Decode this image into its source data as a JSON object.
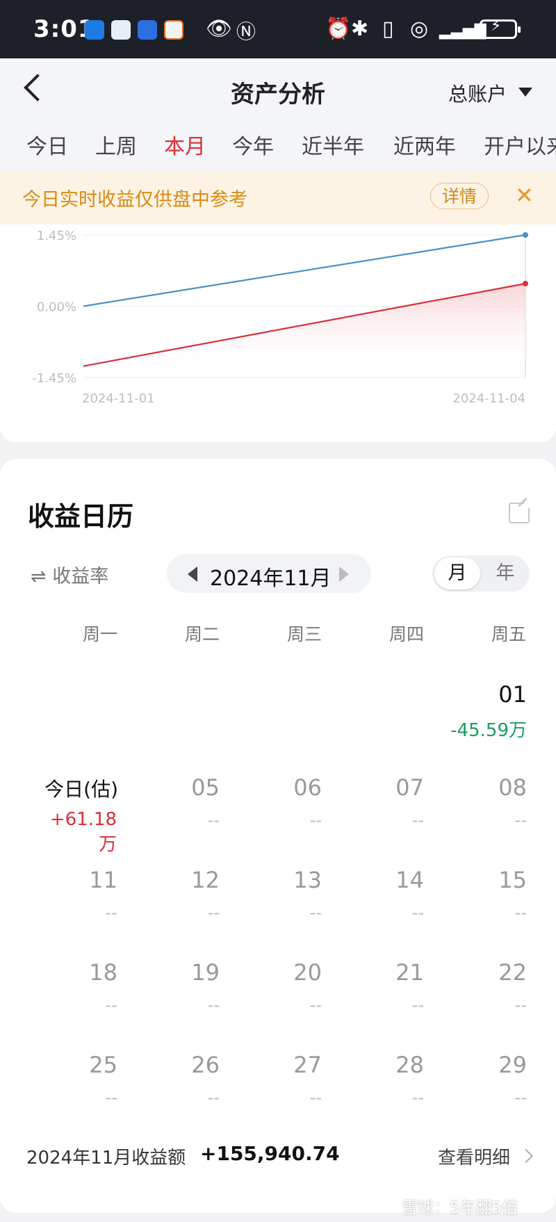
{
  "status_bar": {
    "time": "3:01"
  },
  "header": {
    "title": "资产分析",
    "account": "总账户",
    "tabs": [
      "今日",
      "上周",
      "本月",
      "今年",
      "近半年",
      "近两年",
      "开户以来"
    ],
    "active_tab": "本月"
  },
  "notice": {
    "text": "今日实时收益仅供盘中参考",
    "detail": "详情",
    "close": "✕"
  },
  "chart_data": {
    "type": "line",
    "x": [
      "2024-11-01",
      "2024-11-04"
    ],
    "y_ticks": [
      "1.45%",
      "0.00%",
      "-1.45%"
    ],
    "ylim": [
      -1.45,
      1.45
    ],
    "series": [
      {
        "values": [
          0.0,
          1.45
        ],
        "color": "#4a8fc4"
      },
      {
        "values": [
          -1.22,
          0.46
        ],
        "color": "#d8303a"
      }
    ]
  },
  "calendar": {
    "title": "收益日历",
    "rate_toggle": "⇌ 收益率",
    "month": "2024年11月",
    "seg_month": "月",
    "seg_year": "年",
    "weekdays": [
      "周一",
      "周二",
      "周三",
      "周四",
      "周五"
    ],
    "first": {
      "day": "01",
      "pnl": "-45.59万"
    },
    "today": {
      "label": "今日(估)",
      "pnl": "+61.18万"
    },
    "row1": [
      "05",
      "06",
      "07",
      "08"
    ],
    "row2": [
      "11",
      "12",
      "13",
      "14",
      "15"
    ],
    "row3": [
      "18",
      "19",
      "20",
      "21",
      "22"
    ],
    "row4": [
      "25",
      "26",
      "27",
      "28",
      "29"
    ],
    "empty": "--"
  },
  "footer": {
    "label": "2024年11月收益额",
    "value": "+155,940.74",
    "link": "查看明细"
  },
  "watermark": "雪球：5年翻5倍"
}
